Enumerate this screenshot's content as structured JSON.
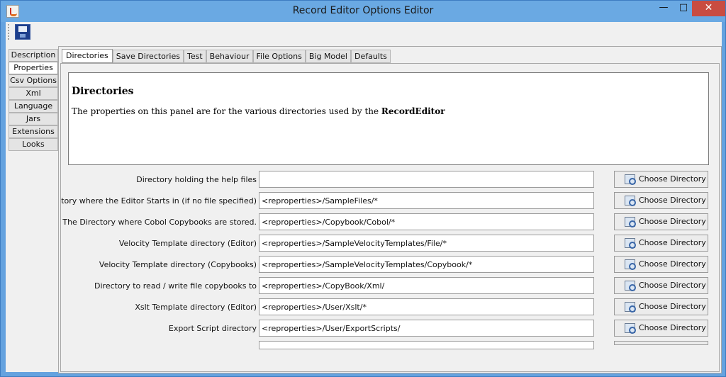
{
  "window": {
    "title": "Record Editor Options Editor",
    "minimize_glyph": "—",
    "maximize_glyph": "□",
    "close_glyph": "✕"
  },
  "toolbar": {
    "save_icon": "floppy-disk-icon"
  },
  "side_tabs": [
    "Description",
    "Properties",
    "Csv Options",
    "Xml",
    "Language",
    "Jars",
    "Extensions",
    "Looks"
  ],
  "side_tabs_active": "Properties",
  "top_tabs": [
    "Directories",
    "Save Directories",
    "Test",
    "Behaviour",
    "File Options",
    "Big Model",
    "Defaults"
  ],
  "top_tabs_active": "Directories",
  "description": {
    "heading": "Directories",
    "text": "The properties on this panel are for the various directories used by the ",
    "text_bold": "RecordEditor"
  },
  "button_label": "Choose Directory",
  "rows": [
    {
      "label": "Directory holding the help files",
      "value": ""
    },
    {
      "label": "Directory where the Editor Starts in (if no file specified)",
      "value": "<reproperties>/SampleFiles/*"
    },
    {
      "label": "The Directory where Cobol Copybooks are stored.",
      "value": "<reproperties>/Copybook/Cobol/*"
    },
    {
      "label": "Velocity Template directory (Editor)",
      "value": "<reproperties>/SampleVelocityTemplates/File/*"
    },
    {
      "label": "Velocity Template directory (Copybooks)",
      "value": "<reproperties>/SampleVelocityTemplates/Copybook/*"
    },
    {
      "label": "Directory to read / write file copybooks to",
      "value": "<reproperties>/CopyBook/Xml/"
    },
    {
      "label": "Xslt Template directory (Editor)",
      "value": "<reproperties>/User/Xslt/*"
    },
    {
      "label": "Export Script directory",
      "value": "<reproperties>/User/ExportScripts/"
    }
  ],
  "colors": {
    "titlebar": "#6aa9e3",
    "close_button": "#c94c41",
    "panel": "#f0f0f0"
  }
}
